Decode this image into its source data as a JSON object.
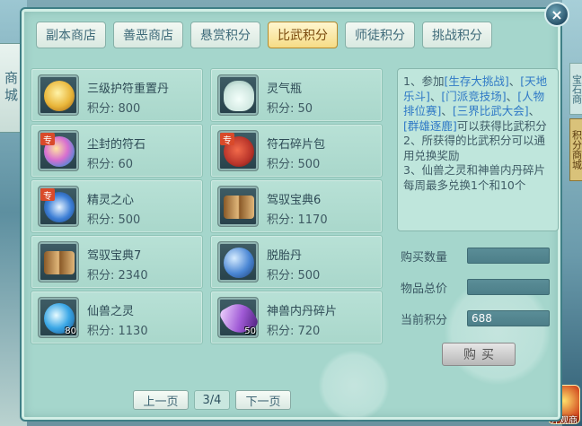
{
  "side": {
    "left_label": "商城",
    "right_hint": "宝石商",
    "right_tab": "积分商城",
    "corner_text": "外观商"
  },
  "window": {
    "close_label": "×"
  },
  "tabs": [
    {
      "label": "副本商店",
      "active": false
    },
    {
      "label": "善恶商店",
      "active": false
    },
    {
      "label": "悬赏积分",
      "active": false
    },
    {
      "label": "比武积分",
      "active": true
    },
    {
      "label": "师徒积分",
      "active": false
    },
    {
      "label": "挑战积分",
      "active": false
    }
  ],
  "items": [
    {
      "name": "三级护符重置丹",
      "price_label": "积分: 800",
      "icon": "golden-flower-icon",
      "color": "#e9b63a",
      "special": "",
      "qty": ""
    },
    {
      "name": "灵气瓶",
      "price_label": "积分: 50",
      "icon": "spirit-bottle-icon",
      "color": "#cfe7e0",
      "special": "",
      "qty": ""
    },
    {
      "name": "尘封的符石",
      "price_label": "积分: 60",
      "icon": "sealed-rune-stone-icon",
      "color": "#d76fd0",
      "special": "专",
      "qty": ""
    },
    {
      "name": "符石碎片包",
      "price_label": "积分: 500",
      "icon": "rune-fragment-bag-icon",
      "color": "#b8342a",
      "special": "专",
      "qty": ""
    },
    {
      "name": "精灵之心",
      "price_label": "积分: 500",
      "icon": "spirit-heart-icon",
      "color": "#3d7fd6",
      "special": "专",
      "qty": ""
    },
    {
      "name": "驾驭宝典6",
      "price_label": "积分: 1170",
      "icon": "book-icon",
      "color": "#b98a4e",
      "special": "",
      "qty": ""
    },
    {
      "name": "驾驭宝典7",
      "price_label": "积分: 2340",
      "icon": "book-icon",
      "color": "#b98a4e",
      "special": "",
      "qty": ""
    },
    {
      "name": "脱胎丹",
      "price_label": "积分: 500",
      "icon": "reborn-pill-icon",
      "color": "#4a86d4",
      "special": "",
      "qty": ""
    },
    {
      "name": "仙兽之灵",
      "price_label": "积分: 1130",
      "icon": "beast-spirit-orb-icon",
      "color": "#3aa7e6",
      "special": "",
      "qty": "80"
    },
    {
      "name": "神兽内丹碎片",
      "price_label": "积分: 720",
      "icon": "divine-core-shard-icon",
      "color": "#a05ad6",
      "special": "",
      "qty": "50"
    }
  ],
  "pager": {
    "prev_label": "上一页",
    "page": "3/4",
    "next_label": "下一页"
  },
  "info": {
    "line1_prefix": "1、参加",
    "e1": "[生存大挑战]",
    "sep1": "、",
    "e2": "[天地乐斗]",
    "sep2": "、",
    "e3": "[门派竞技场]",
    "sep3": "、",
    "e4": "[人物排位赛]",
    "sep4": "、",
    "e5": "[三界比武大会]",
    "sep5": "、",
    "e6": "[群雄逐鹿]",
    "line1_suffix": "可以获得比武积分",
    "line2": "2、所获得的比武积分可以通用兑换奖励",
    "line3": "3、仙兽之灵和神兽内丹碎片每周最多兑换1个和10个"
  },
  "form": {
    "qty_label": "购买数量",
    "qty_value": "",
    "total_label": "物品总价",
    "total_value": "",
    "points_label": "当前积分",
    "points_value": "688"
  },
  "buy_label": "购买"
}
